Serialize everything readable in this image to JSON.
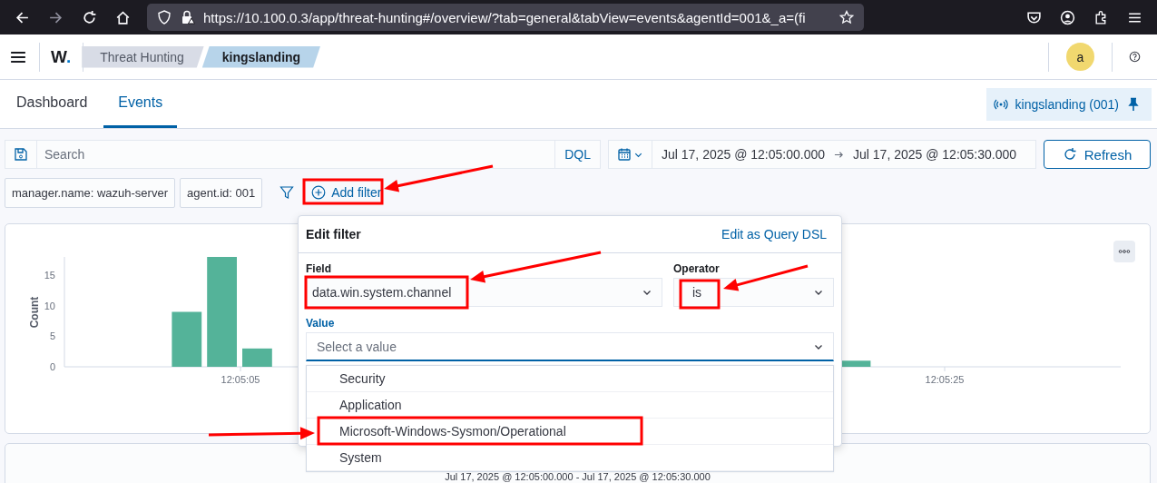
{
  "browser": {
    "url": "https://10.100.0.3/app/threat-hunting#/overview/?tab=general&tabView=events&agentId=001&_a=(fi"
  },
  "header": {
    "logo": "W",
    "logo_dot": ".",
    "breadcrumbs": [
      {
        "label": "Threat Hunting",
        "selected": false
      },
      {
        "label": "kingslanding",
        "selected": true
      }
    ],
    "avatar": "a"
  },
  "tabs": [
    {
      "label": "Dashboard",
      "selected": false
    },
    {
      "label": "Events",
      "selected": true
    }
  ],
  "agent_badge": "kingslanding (001)",
  "search": {
    "placeholder": "Search",
    "language": "DQL"
  },
  "time_range": {
    "start": "Jul 17, 2025 @ 12:05:00.000",
    "end": "Jul 17, 2025 @ 12:05:30.000"
  },
  "refresh_button": "Refresh",
  "filters": [
    {
      "label": "manager.name: wazuh-server"
    },
    {
      "label": "agent.id: 001"
    }
  ],
  "add_filter": "Add filter",
  "histogram": {
    "chart_data": {
      "type": "bar",
      "ylabel": "Count",
      "categories": [
        null,
        null,
        null,
        null,
        null,
        "12:05:05",
        null,
        null,
        null,
        null,
        null,
        null,
        null,
        null,
        null,
        null,
        null,
        null,
        null,
        null,
        null,
        null,
        null,
        null,
        null,
        "12:05:25",
        null,
        null,
        null,
        null
      ],
      "values": [
        0,
        0,
        0,
        9,
        18,
        3,
        null,
        null,
        null,
        null,
        null,
        null,
        null,
        null,
        null,
        null,
        null,
        null,
        null,
        null,
        null,
        null,
        1,
        0,
        0,
        0,
        0,
        0,
        0,
        0
      ],
      "ylim": [
        0,
        18
      ],
      "yticks": [
        0,
        5,
        10,
        15
      ]
    }
  },
  "edit_filter": {
    "title": "Edit filter",
    "dsl_link": "Edit as Query DSL",
    "field": {
      "label": "Field",
      "value": "data.win.system.channel"
    },
    "operator": {
      "label": "Operator",
      "value": "is"
    },
    "value": {
      "label": "Value",
      "placeholder": "Select a value",
      "options": [
        {
          "label": "Security",
          "selected": false
        },
        {
          "label": "Application",
          "selected": false
        },
        {
          "label": "Microsoft-Windows-Sysmon/Operational",
          "selected": false
        },
        {
          "label": "System",
          "selected": false
        }
      ]
    }
  },
  "footer_range": "Jul 17, 2025 @ 12:05:00.000 - Jul 17, 2025 @ 12:05:30.000"
}
